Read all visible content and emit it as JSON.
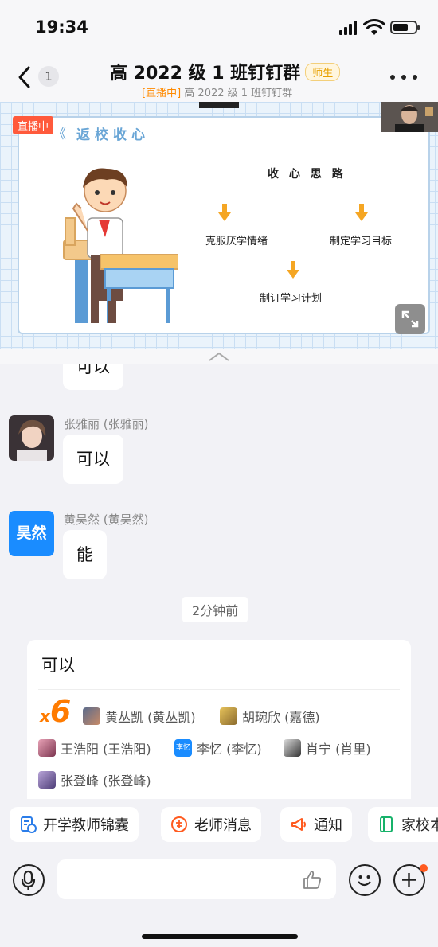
{
  "status_bar": {
    "time": "19:34"
  },
  "header": {
    "back_count": "1",
    "title": "高 2022 级 1 班钉钉群",
    "role_tag": "师生",
    "subtitle_live": "[直播中]",
    "subtitle_text": "高 2022 级 1 班钉钉群"
  },
  "live": {
    "badge": "直播中",
    "slide": {
      "title": "返校收心",
      "heading": "收 心 思 路",
      "items": [
        "克服厌学情绪",
        "制定学习目标",
        "制订学习计划"
      ]
    }
  },
  "messages": [
    {
      "sender": "",
      "text": "可以"
    },
    {
      "sender": "张雅丽 (张雅丽)",
      "text": "可以",
      "avatar_type": "photo"
    },
    {
      "sender": "黄昊然 (黄昊然)",
      "text": "能",
      "avatar_text": "昊然",
      "avatar_color": "#1a8cff"
    }
  ],
  "time_divider": "2分钟前",
  "plus_one": {
    "text": "可以",
    "prefix": "x",
    "count": "6",
    "members": [
      "黄丛凯 (黄丛凯)",
      "胡琬欣 (嘉德)",
      "王浩阳 (王浩阳)",
      "李忆 (李忆)",
      "肖宁 (肖里)",
      "张登峰 (张登峰)"
    ],
    "member_avatar_text": "李忆"
  },
  "quick_actions": [
    {
      "label": "开学教师锦囊",
      "icon": "doc-clock-icon",
      "color": "#2b7de9"
    },
    {
      "label": "老师消息",
      "icon": "teacher-icon",
      "color": "#ff5a1f"
    },
    {
      "label": "通知",
      "icon": "megaphone-icon",
      "color": "#ff5a1f"
    },
    {
      "label": "家校本",
      "icon": "notebook-icon",
      "color": "#17b26a"
    }
  ],
  "input": {
    "placeholder": ""
  },
  "colors": {
    "accent": "#1a8cff",
    "live": "#ff5a3c",
    "orange": "#ff7b00"
  }
}
